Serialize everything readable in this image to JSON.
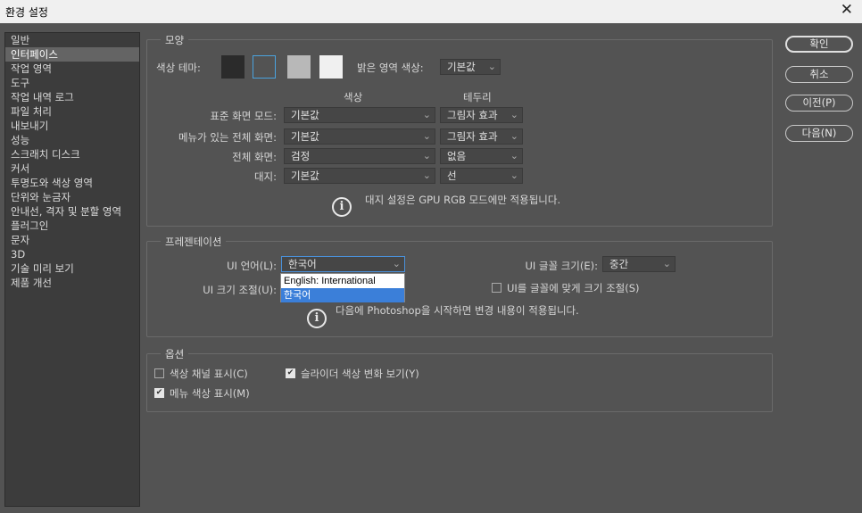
{
  "window": {
    "title": "환경 설정",
    "close_glyph": "✕"
  },
  "sidebar": {
    "items": [
      "일반",
      "인터페이스",
      "작업 영역",
      "도구",
      "작업 내역 로그",
      "파일 처리",
      "내보내기",
      "성능",
      "스크래치 디스크",
      "커서",
      "투명도와 색상 영역",
      "단위와 눈금자",
      "안내선, 격자 및 분할 영역",
      "플러그인",
      "문자",
      "3D",
      "기술 미리 보기",
      "제품 개선"
    ],
    "selected_index": 1
  },
  "appearance": {
    "group_label": "모양",
    "color_theme_label": "색상 테마:",
    "theme_swatches": [
      "#2b2b2b",
      "#535353",
      "#b8b8b8",
      "#f0f0f0"
    ],
    "selected_swatch": 1,
    "highlight_label": "밝은 영역 색상:",
    "highlight_value": "기본값",
    "col_color": "색상",
    "col_border": "테두리",
    "rows": [
      {
        "label": "표준 화면 모드:",
        "color": "기본값",
        "border": "그림자 효과"
      },
      {
        "label": "메뉴가 있는 전체 화면:",
        "color": "기본값",
        "border": "그림자 효과"
      },
      {
        "label": "전체 화면:",
        "color": "검정",
        "border": "없음"
      },
      {
        "label": "대지:",
        "color": "기본값",
        "border": "선"
      }
    ],
    "info": "대지 설정은 GPU RGB 모드에만 적용됩니다."
  },
  "presentation": {
    "group_label": "프레젠테이션",
    "ui_language_label": "UI 언어(L):",
    "ui_language_value": "한국어",
    "ui_language_options": [
      "English: International",
      "한국어"
    ],
    "ui_font_size_label": "UI 글꼴 크기(E):",
    "ui_font_size_value": "중간",
    "ui_scale_label": "UI 크기 조절(U):",
    "scale_to_font_label": "UI를 글꼴에 맞게 크기 조절(S)",
    "scale_to_font_checked": false,
    "info": "다음에 Photoshop을 시작하면 변경 내용이 적용됩니다."
  },
  "options": {
    "group_label": "옵션",
    "show_channels_label": "색상 채널 표시(C)",
    "show_channels_checked": false,
    "dynamic_sliders_label": "슬라이더 색상 변화 보기(Y)",
    "dynamic_sliders_checked": true,
    "menu_colors_label": "메뉴 색상 표시(M)",
    "menu_colors_checked": true
  },
  "buttons": {
    "ok": "확인",
    "cancel": "취소",
    "prev": "이전(P)",
    "next": "다음(N)"
  },
  "icons": {
    "chevron": "⌄",
    "check": "✔",
    "info": "i"
  }
}
